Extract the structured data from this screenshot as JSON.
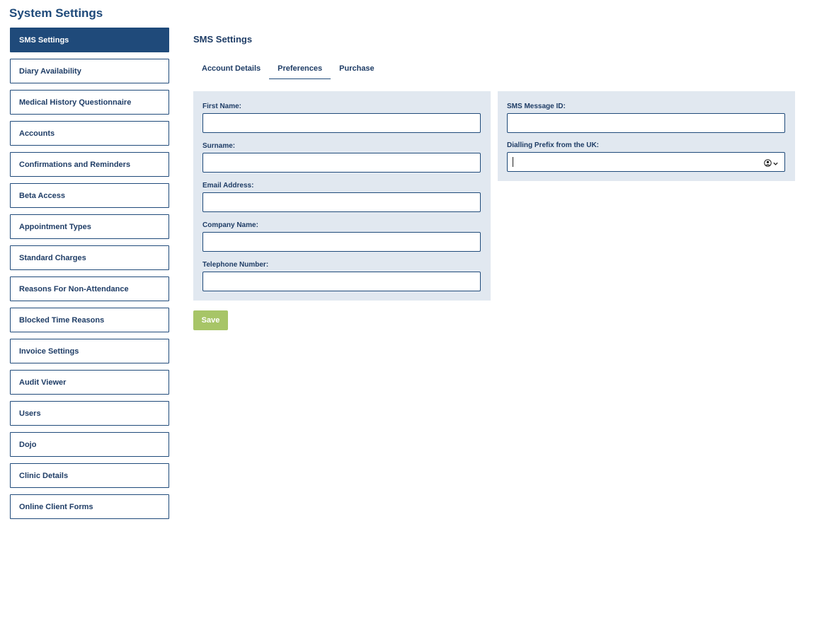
{
  "page": {
    "title": "System Settings"
  },
  "sidebar": {
    "items": [
      {
        "label": "SMS Settings",
        "active": true
      },
      {
        "label": "Diary Availability"
      },
      {
        "label": "Medical History Questionnaire"
      },
      {
        "label": "Accounts"
      },
      {
        "label": "Confirmations and Reminders"
      },
      {
        "label": "Beta Access"
      },
      {
        "label": "Appointment Types"
      },
      {
        "label": "Standard Charges"
      },
      {
        "label": "Reasons For Non-Attendance"
      },
      {
        "label": "Blocked Time Reasons"
      },
      {
        "label": "Invoice Settings"
      },
      {
        "label": "Audit Viewer"
      },
      {
        "label": "Users"
      },
      {
        "label": "Dojo"
      },
      {
        "label": "Clinic Details"
      },
      {
        "label": "Online Client Forms"
      }
    ]
  },
  "main": {
    "title": "SMS Settings",
    "tabs": [
      {
        "label": "Account Details"
      },
      {
        "label": "Preferences",
        "active": true
      },
      {
        "label": "Purchase"
      }
    ],
    "form_left": {
      "first_name": {
        "label": "First Name:",
        "value": ""
      },
      "surname": {
        "label": "Surname:",
        "value": ""
      },
      "email": {
        "label": "Email Address:",
        "value": ""
      },
      "company": {
        "label": "Company Name:",
        "value": ""
      },
      "telephone": {
        "label": "Telephone Number:",
        "value": ""
      }
    },
    "form_right": {
      "sms_message_id": {
        "label": "SMS Message ID:",
        "value": ""
      },
      "dialling_prefix": {
        "label": "Dialling Prefix from the UK:",
        "value": ""
      }
    },
    "save_label": "Save"
  },
  "colors": {
    "brand": "#1f4a7a",
    "panel_bg": "#e1e8f0",
    "save_bg": "#a7c567"
  },
  "icons": {
    "account": "user-circle-icon",
    "dropdown": "chevron-down-icon"
  }
}
